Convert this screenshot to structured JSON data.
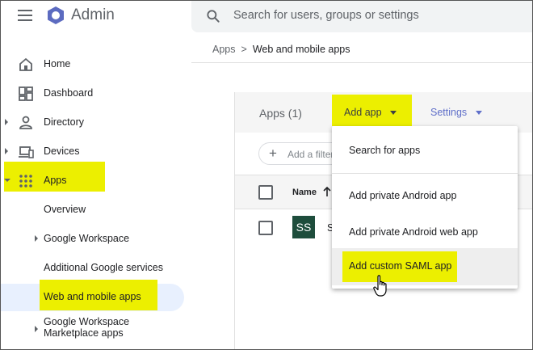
{
  "header": {
    "brand": "Admin",
    "search_placeholder": "Search for users, groups or settings"
  },
  "sidebar": {
    "items": [
      {
        "label": "Home",
        "icon": "home-icon"
      },
      {
        "label": "Dashboard",
        "icon": "dashboard-icon"
      },
      {
        "label": "Directory",
        "icon": "person-icon"
      },
      {
        "label": "Devices",
        "icon": "devices-icon"
      },
      {
        "label": "Apps",
        "icon": "apps-grid-icon"
      },
      {
        "label": "Overview"
      },
      {
        "label": "Google Workspace"
      },
      {
        "label": "Additional Google services"
      },
      {
        "label": "Web and mobile apps"
      },
      {
        "label": "Google Workspace",
        "label2": "Marketplace apps"
      }
    ]
  },
  "breadcrumb": {
    "root": "Apps",
    "separator": ">",
    "current": "Web and mobile apps"
  },
  "toolbar": {
    "apps_count": "Apps (1)",
    "add_app_label": "Add app",
    "settings_label": "Settings"
  },
  "filter": {
    "placeholder": "Add a filter"
  },
  "table": {
    "column_name": "Name",
    "rows": [
      {
        "avatar": "SS",
        "name": "S"
      }
    ]
  },
  "dropdown": {
    "items": [
      "Search for apps",
      "Add private Android app",
      "Add private Android web app",
      "Add custom SAML app"
    ]
  },
  "colors": {
    "highlight": "#ecef00",
    "accent": "#5f6fc9",
    "selected_nav": "#e8f0fe",
    "logo": "#5c6bc0"
  }
}
